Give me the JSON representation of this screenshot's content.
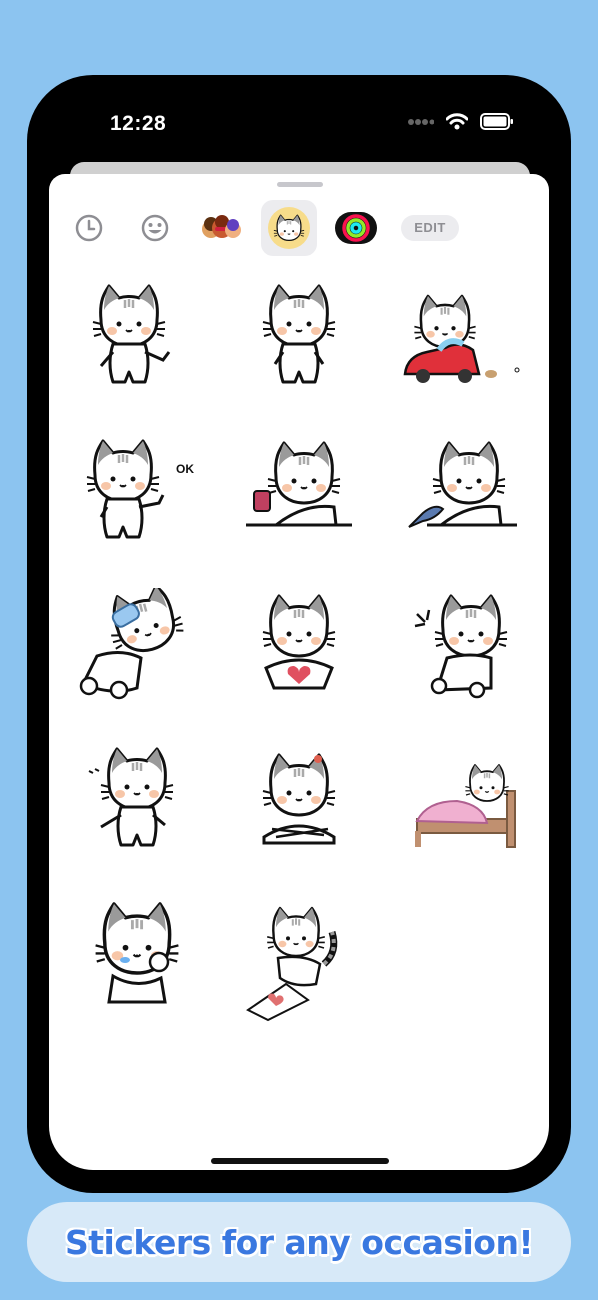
{
  "status_bar": {
    "time": "12:28",
    "icons": [
      "signal-dots-icon",
      "wifi-icon",
      "battery-icon"
    ]
  },
  "tabs": [
    {
      "name": "recents-icon",
      "active": false
    },
    {
      "name": "emoji-icon",
      "active": false
    },
    {
      "name": "memoji-icon",
      "active": false
    },
    {
      "name": "cat-sticker-pack-icon",
      "active": true
    },
    {
      "name": "activity-rings-icon",
      "active": false
    }
  ],
  "edit_label": "EDIT",
  "stickers": [
    "cat-waving",
    "cat-standing",
    "cat-driving-car",
    "cat-ok",
    "cat-drinking",
    "cat-with-fish",
    "cat-drinking-bottle",
    "cat-holding-heart",
    "cat-laughing",
    "cat-dancing",
    "cat-arms-crossed",
    "cat-in-bed",
    "cat-crying",
    "cat-drawing-heart"
  ],
  "sticker_text": {
    "ok": "OK"
  },
  "caption": "Stickers for any occasion!",
  "colors": {
    "background": "#8cc4f0",
    "caption_text": "#3a78e0",
    "caption_bg": "#d7e9f8"
  }
}
